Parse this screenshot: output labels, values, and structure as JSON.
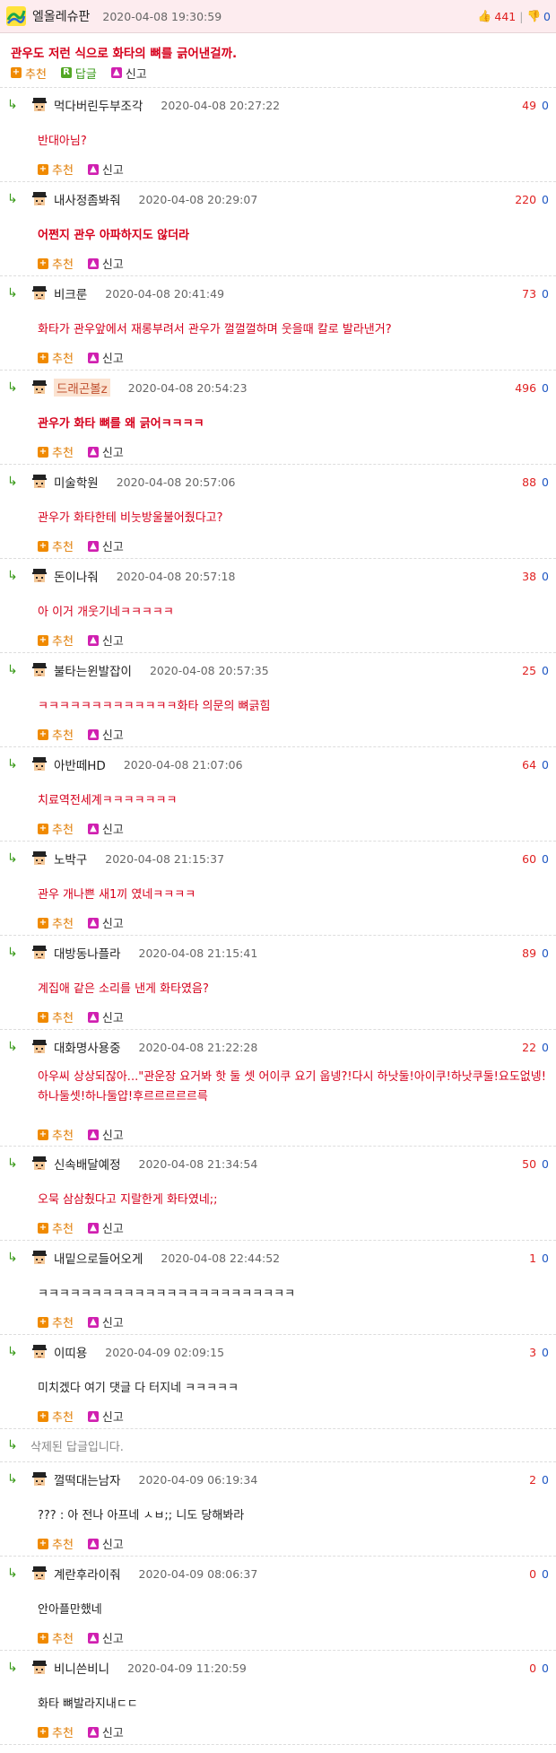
{
  "post": {
    "nick": "엘올레슈판",
    "time": "2020-04-08 19:30:59",
    "up": "441",
    "down": "0",
    "body": "관우도 저런 식으로 화타의 뼈를 긁어낸걸까.",
    "actions": {
      "recommend": "추천",
      "reply": "답글",
      "report": "신고"
    }
  },
  "replies": [
    {
      "nick": "먹다버린두부조각",
      "time": "2020-04-08 20:27:22",
      "up": "49",
      "down": "0",
      "body": "반대아님?"
    },
    {
      "nick": "내사정좀봐줘",
      "time": "2020-04-08 20:29:07",
      "up": "220",
      "down": "0",
      "body": "어쩐지 관우 아파하지도 않더라"
    },
    {
      "nick": "비크룬",
      "time": "2020-04-08 20:41:49",
      "up": "73",
      "down": "0",
      "body": "화타가 관우앞에서 재롱부려서 관우가 껄껄껄하며 웃을때 칼로 발라낸거?"
    },
    {
      "nick": "드래곤볼z",
      "time": "2020-04-08 20:54:23",
      "up": "496",
      "down": "0",
      "body": "관우가 화타 뼈를 왜 긁어ㅋㅋㅋㅋ"
    },
    {
      "nick": "미술학원",
      "time": "2020-04-08 20:57:06",
      "up": "88",
      "down": "0",
      "body": "관우가 화타한테 비눗방울불어줬다고?"
    },
    {
      "nick": "돈이나줘",
      "time": "2020-04-08 20:57:18",
      "up": "38",
      "down": "0",
      "body": "아 이거 개웃기네ㅋㅋㅋㅋㅋ"
    },
    {
      "nick": "불타는윈발잡이",
      "time": "2020-04-08 20:57:35",
      "up": "25",
      "down": "0",
      "body": "ㅋㅋㅋㅋㅋㅋㅋㅋㅋㅋㅋㅋㅋ화타 의문의 뼈긁힘"
    },
    {
      "nick": "아반떼HD",
      "time": "2020-04-08 21:07:06",
      "up": "64",
      "down": "0",
      "body": "치료역전세계ㅋㅋㅋㅋㅋㅋㅋ"
    },
    {
      "nick": "노박구",
      "time": "2020-04-08 21:15:37",
      "up": "60",
      "down": "0",
      "body": "관우 개나쁜 새1끼 였네ㅋㅋㅋㅋ"
    },
    {
      "nick": "대방동나플라",
      "time": "2020-04-08 21:15:41",
      "up": "89",
      "down": "0",
      "body": "계집애 같은 소리를 낸게 화타였음?"
    },
    {
      "nick": "대화명사용중",
      "time": "2020-04-08 21:22:28",
      "up": "22",
      "down": "0",
      "body": "아우씨 상상되잖아...\"관운장 요거봐 핫 둘 셋 어이쿠 요기 웁넹?!다시 하낫둘!아이쿠!하낫쿠둘!요도없넹!하나둘셋!하나둘얍!후르르르르르륵"
    },
    {
      "nick": "신속배달예정",
      "time": "2020-04-08 21:34:54",
      "up": "50",
      "down": "0",
      "body": "오묵 삼삼췄다고 지랄한게 화타였네;;"
    },
    {
      "nick": "내밑으로들어오게",
      "time": "2020-04-08 22:44:52",
      "up": "1",
      "down": "0",
      "body": "ㅋㅋㅋㅋㅋㅋㅋㅋㅋㅋㅋㅋㅋㅋㅋㅋㅋㅋㅋㅋㅋㅋㅋㅋ"
    },
    {
      "nick": "이띠용",
      "time": "2020-04-09 02:09:15",
      "up": "3",
      "down": "0",
      "body": "미치겠다 여기 댓글 다 터지네 ㅋㅋㅋㅋㅋ"
    },
    {
      "nick": "껄떡대는남자",
      "time": "2020-04-09 06:19:34",
      "up": "2",
      "down": "0",
      "body": "??? : 아 전나 아프네 ㅅㅂ;; 니도 당해봐라"
    },
    {
      "nick": "계란후라이줘",
      "time": "2020-04-09 08:06:37",
      "up": "0",
      "down": "0",
      "body": "안아플만했네"
    },
    {
      "nick": "비니쓴비니",
      "time": "2020-04-09 11:20:59",
      "up": "0",
      "down": "0",
      "body": "화타 뼈발라지내ㄷㄷ"
    }
  ],
  "deleted_text": "삭제된 답글입니다.",
  "actions": {
    "recommend": "추천",
    "report": "신고"
  },
  "colors": {
    "header_bg": "#fdecef",
    "accent_red": "#d6001c",
    "vote_up": "#e02020",
    "vote_down": "#1f57c3",
    "reply_arrow": "#3a9a1a"
  }
}
